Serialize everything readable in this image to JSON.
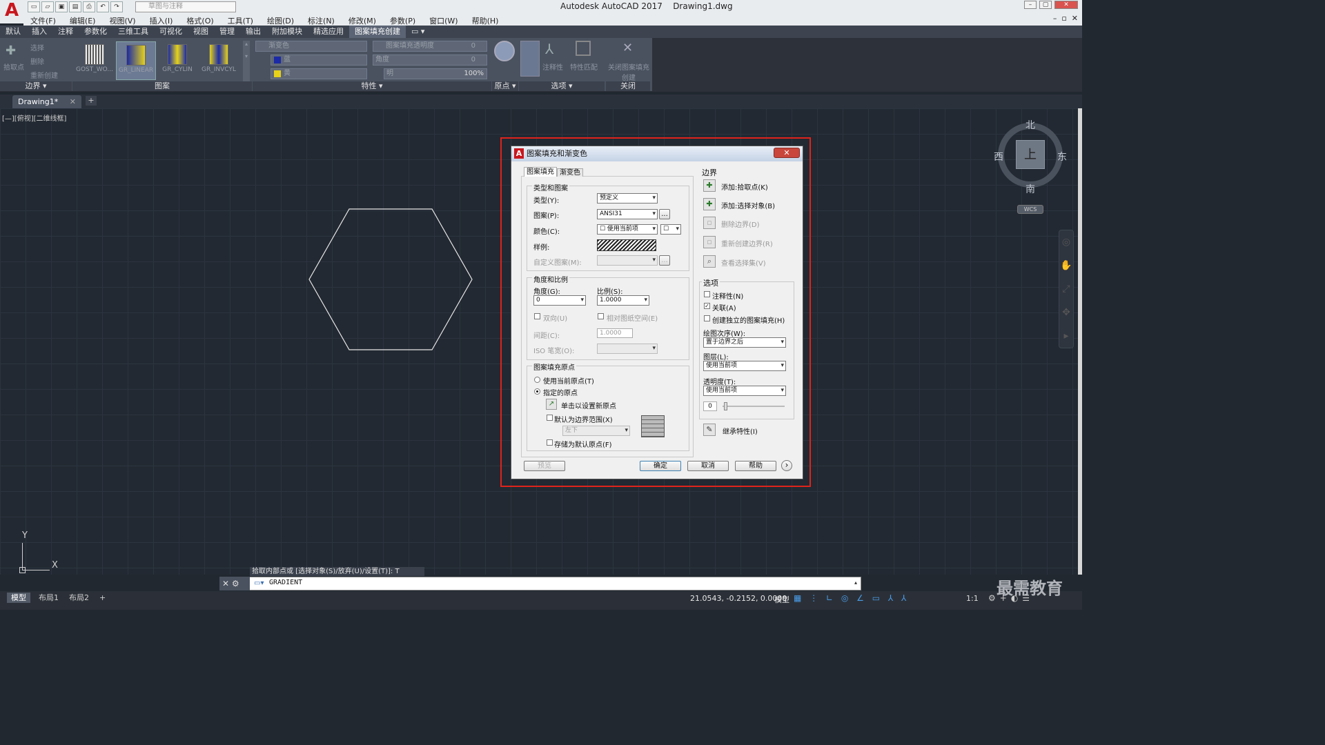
{
  "app": {
    "window_title": "Autodesk AutoCAD 2017",
    "file_name": "Drawing1.dwg",
    "workspace": "草图与注释"
  },
  "menus": [
    "文件(F)",
    "编辑(E)",
    "视图(V)",
    "插入(I)",
    "格式(O)",
    "工具(T)",
    "绘图(D)",
    "标注(N)",
    "修改(M)",
    "参数(P)",
    "窗口(W)",
    "帮助(H)"
  ],
  "ribbon_tabs": [
    "默认",
    "插入",
    "注释",
    "参数化",
    "三维工具",
    "可视化",
    "视图",
    "管理",
    "输出",
    "附加模块",
    "精选应用",
    "图案填充创建"
  ],
  "ribbon": {
    "boundary": {
      "pick": "拾取点",
      "select": "选择",
      "remove": "删除",
      "recreate": "重新创建",
      "caption": "边界 ▾"
    },
    "patterns": [
      "GOST_WO...",
      "GR_LINEAR",
      "GR_CYLIN",
      "GR_INVCYL"
    ],
    "pattern_caption": "图案",
    "props": {
      "type": "渐变色",
      "color1": "蓝",
      "color2": "黄",
      "transparency_label": "图案填充透明度",
      "transparency_value": "0",
      "angle_label": "角度",
      "angle_value": "0",
      "tint_label": "明",
      "tint_value": "100%",
      "caption": "特性 ▾"
    },
    "origin": {
      "set": "设定原点",
      "caption": "原点 ▾"
    },
    "options": {
      "assoc": "关联",
      "annot": "注释性",
      "match": "特性匹配",
      "caption": "选项 ▾"
    },
    "close": {
      "label": "关闭图案填充创建",
      "caption": "关闭"
    }
  },
  "doc_tab": "Drawing1*",
  "view_label": "[—][俯视][二维线框]",
  "viewcube": {
    "north": "北",
    "south": "南",
    "east": "东",
    "west": "西",
    "face": "上",
    "wcs": "WCS"
  },
  "ucs": {
    "x": "X",
    "y": "Y"
  },
  "dialog": {
    "title": "图案填充和渐变色",
    "close": "✕",
    "tabs": [
      "图案填充",
      "渐变色"
    ],
    "type_pattern": {
      "group": "类型和图案",
      "type_label": "类型(Y):",
      "type_value": "预定义",
      "pattern_label": "图案(P):",
      "pattern_value": "ANSI31",
      "color_label": "颜色(C):",
      "color_value": "☐ 使用当前项",
      "color2_value": "☐",
      "swatch_label": "样例:",
      "custom_label": "自定义图案(M):",
      "ellipsis": "..."
    },
    "angle_scale": {
      "group": "角度和比例",
      "angle_label": "角度(G):",
      "angle_value": "0",
      "scale_label": "比例(S):",
      "scale_value": "1.0000",
      "double_label": "双向(U)",
      "paper_label": "相对图纸空间(E)",
      "spacing_label": "间距(C):",
      "spacing_value": "1.0000",
      "iso_label": "ISO 笔宽(O):"
    },
    "origin": {
      "group": "图案填充原点",
      "use_current": "使用当前原点(T)",
      "specified": "指定的原点",
      "click_set": "单击以设置新原点",
      "default_extent": "默认为边界范围(X)",
      "extent_value": "左下",
      "store_default": "存储为默认原点(F)"
    },
    "boundaries": {
      "group": "边界",
      "add_pick": "添加:拾取点(K)",
      "add_select": "添加:选择对象(B)",
      "remove": "删除边界(D)",
      "recreate": "重新创建边界(R)",
      "view_sel": "查看选择集(V)"
    },
    "options": {
      "group": "选项",
      "annotative": "注释性(N)",
      "associative": "关联(A)",
      "separate": "创建独立的图案填充(H)",
      "draw_order_label": "绘图次序(W):",
      "draw_order_value": "置于边界之后",
      "layer_label": "图层(L):",
      "layer_value": "使用当前项",
      "transparency_label": "透明度(T):",
      "transparency_value": "使用当前项",
      "transparency_num": "0"
    },
    "inherit": "继承特性(I)",
    "buttons": {
      "preview": "预览",
      "ok": "确定",
      "cancel": "取消",
      "help": "帮助",
      "more": "›"
    }
  },
  "command": {
    "prompt": "拾取内部点或 [选择对象(S)/放弃(U)/设置(T)]: T",
    "input": "GRADIENT"
  },
  "layout_tabs": [
    "模型",
    "布局1",
    "布局2",
    "+"
  ],
  "status": {
    "coords": "21.0543, -0.2152, 0.0000",
    "model": "模型",
    "scale": "1:1"
  },
  "watermark": "最需教育",
  "colors": {
    "hexagon": "#e8e8e8",
    "highlight_box": "#e0231c",
    "background": "#212830"
  }
}
